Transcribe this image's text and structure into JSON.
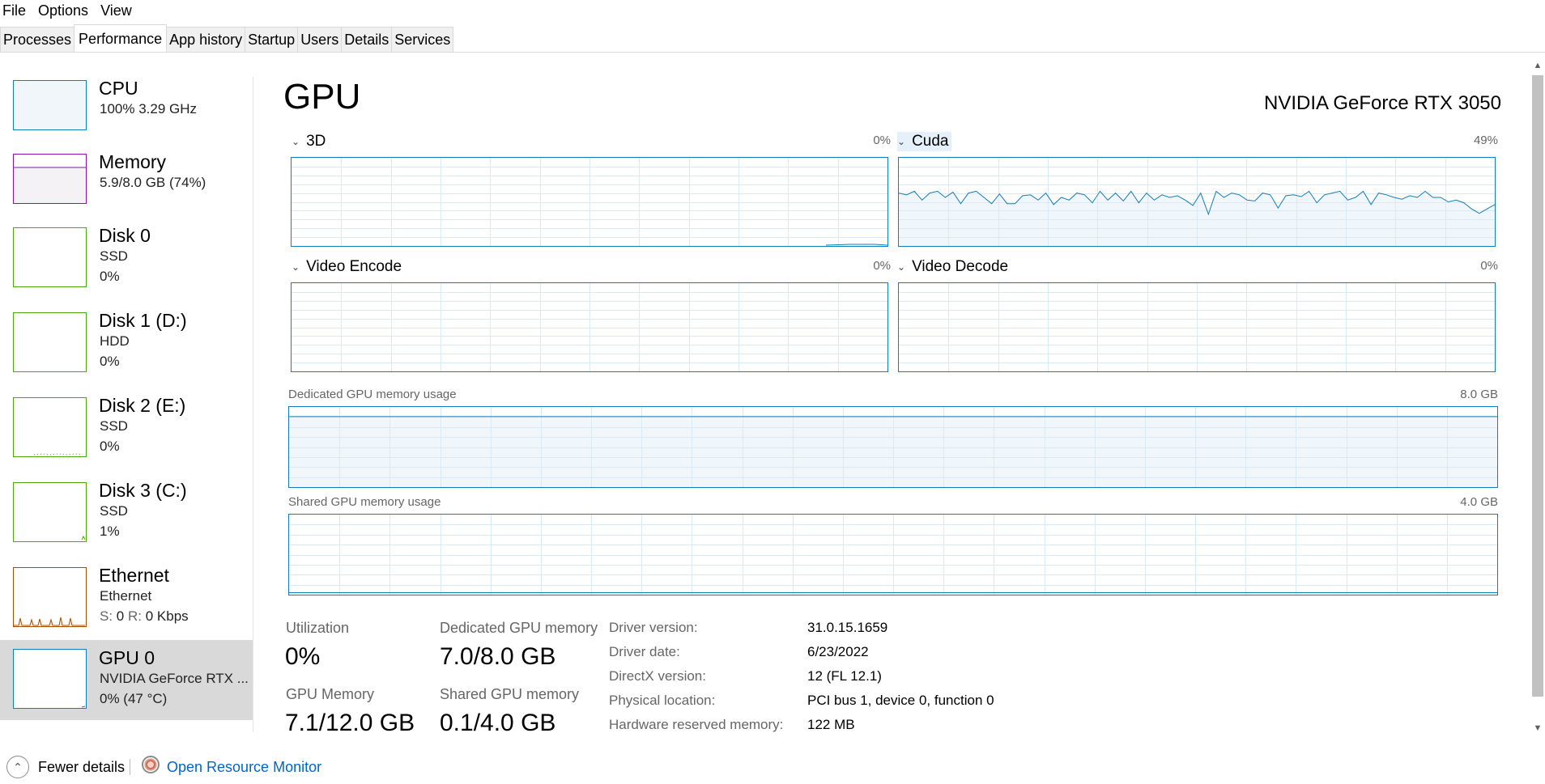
{
  "menu": [
    "File",
    "Options",
    "View"
  ],
  "tabs": [
    "Processes",
    "Performance",
    "App history",
    "Startup",
    "Users",
    "Details",
    "Services"
  ],
  "active_tab": "Performance",
  "sidebar": {
    "items": [
      {
        "title": "CPU",
        "line1": "100%  3.29 GHz",
        "line2": "",
        "color": "#117dbb"
      },
      {
        "title": "Memory",
        "line1": "5.9/8.0 GB (74%)",
        "line2": "",
        "color": "#8b12ae"
      },
      {
        "title": "Disk 0",
        "line1": "SSD",
        "line2": "0%",
        "color": "#4da60c"
      },
      {
        "title": "Disk 1 (D:)",
        "line1": "HDD",
        "line2": "0%",
        "color": "#4da60c"
      },
      {
        "title": "Disk 2 (E:)",
        "line1": "SSD",
        "line2": "0%",
        "color": "#4da60c"
      },
      {
        "title": "Disk 3 (C:)",
        "line1": "SSD",
        "line2": "1%",
        "color": "#4da60c"
      },
      {
        "title": "Ethernet",
        "line1": "Ethernet",
        "line2_s_label": "S:",
        "line2_s_val": "0",
        "line2_r_label": "R:",
        "line2_r_val": "0 Kbps",
        "color": "#a74f01"
      },
      {
        "title": "GPU 0",
        "line1": "NVIDIA GeForce RTX ...",
        "line2": "0%  (47 °C)",
        "color": "#117dbb",
        "selected": true
      }
    ]
  },
  "main": {
    "title": "GPU",
    "model": "NVIDIA GeForce RTX 3050",
    "engines": [
      {
        "name": "3D",
        "percent": "0%"
      },
      {
        "name": "Cuda",
        "percent": "49%"
      },
      {
        "name": "Video Encode",
        "percent": "0%"
      },
      {
        "name": "Video Decode",
        "percent": "0%"
      }
    ],
    "dedicated_label": "Dedicated GPU memory usage",
    "dedicated_max": "8.0 GB",
    "shared_label": "Shared GPU memory usage",
    "shared_max": "4.0 GB",
    "cuda_series": [
      0.6,
      0.58,
      0.62,
      0.52,
      0.6,
      0.62,
      0.55,
      0.61,
      0.48,
      0.6,
      0.62,
      0.55,
      0.48,
      0.59,
      0.48,
      0.48,
      0.57,
      0.58,
      0.52,
      0.6,
      0.47,
      0.55,
      0.52,
      0.6,
      0.58,
      0.49,
      0.62,
      0.52,
      0.6,
      0.51,
      0.62,
      0.49,
      0.6,
      0.52,
      0.58,
      0.55,
      0.57,
      0.52,
      0.46,
      0.6,
      0.36,
      0.62,
      0.55,
      0.6,
      0.58,
      0.52,
      0.51,
      0.6,
      0.58,
      0.43,
      0.57,
      0.58,
      0.56,
      0.62,
      0.49,
      0.58,
      0.6,
      0.62,
      0.52,
      0.55,
      0.62,
      0.47,
      0.6,
      0.58,
      0.55,
      0.53,
      0.57,
      0.55,
      0.62,
      0.55,
      0.55,
      0.5,
      0.52,
      0.49,
      0.42,
      0.37,
      0.42,
      0.47
    ],
    "dedicated_level": 0.88,
    "shared_level": 0.025
  },
  "stats": {
    "utilization_label": "Utilization",
    "utilization_value": "0%",
    "dedicated_mem_label": "Dedicated GPU memory",
    "dedicated_mem_value": "7.0/8.0 GB",
    "gpu_mem_label": "GPU Memory",
    "gpu_mem_value": "7.1/12.0 GB",
    "shared_mem_label": "Shared GPU memory",
    "shared_mem_value": "0.1/4.0 GB"
  },
  "properties": [
    {
      "label": "Driver version:",
      "value": "31.0.15.1659"
    },
    {
      "label": "Driver date:",
      "value": "6/23/2022"
    },
    {
      "label": "DirectX version:",
      "value": "12 (FL 12.1)"
    },
    {
      "label": "Physical location:",
      "value": "PCI bus 1, device 0, function 0"
    },
    {
      "label": "Hardware reserved memory:",
      "value": "122 MB"
    }
  ],
  "footer": {
    "fewer_details": "Fewer details",
    "open_monitor": "Open Resource Monitor"
  },
  "icons": [
    "chevron-up-icon",
    "resource-monitor-icon",
    "chevron-down-icon",
    "scroll-up-icon",
    "scroll-down-icon"
  ]
}
